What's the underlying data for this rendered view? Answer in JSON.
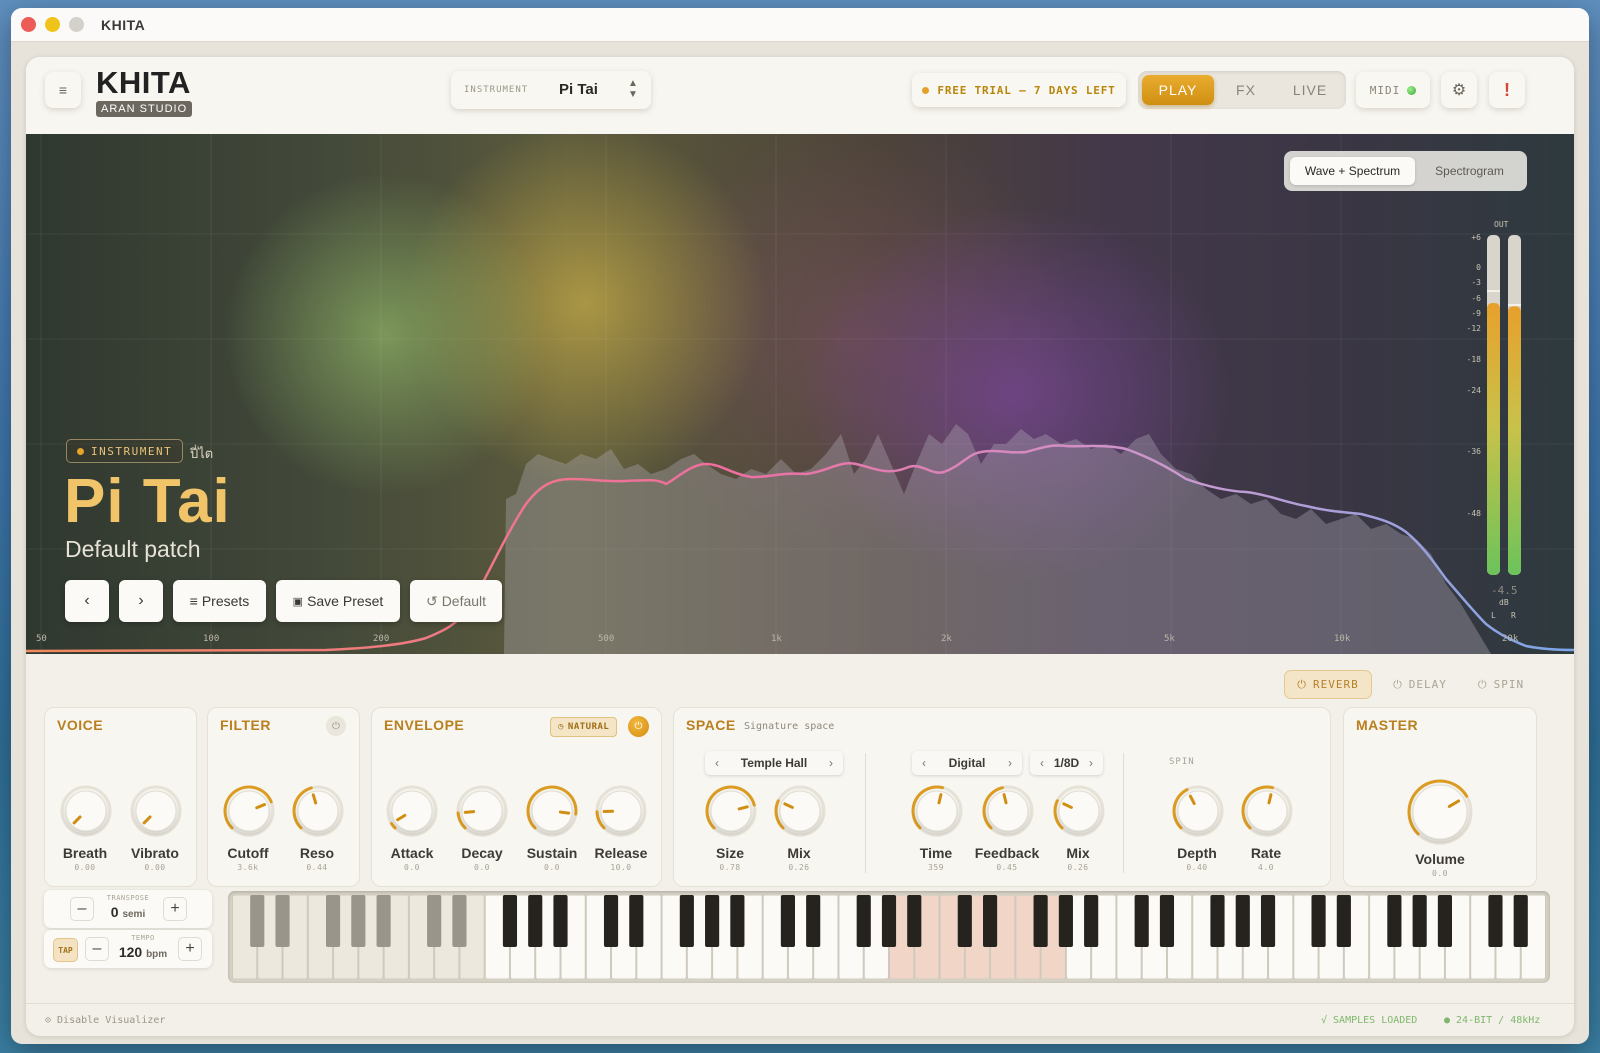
{
  "window": {
    "title": "KHITA"
  },
  "brand": {
    "name": "KHITA",
    "sub": "ARAN STUDIO"
  },
  "instrument_selector": {
    "label": "INSTRUMENT",
    "value": "Pi Tai"
  },
  "trial": {
    "text": "FREE TRIAL — 7 DAYS LEFT"
  },
  "modes": [
    {
      "label": "PLAY",
      "active": true
    },
    {
      "label": "FX",
      "active": false
    },
    {
      "label": "LIVE",
      "active": false
    }
  ],
  "midi": {
    "label": "MIDI"
  },
  "alert": {
    "label": "!"
  },
  "visualizer": {
    "views": [
      {
        "label": "Wave + Spectrum",
        "active": true
      },
      {
        "label": "Spectrogram",
        "active": false
      }
    ],
    "badge": "INSTRUMENT",
    "thai_name": "ปี่ไต",
    "name": "Pi Tai",
    "patch": "Default patch",
    "presets_label": "Presets",
    "save_label": "Save Preset",
    "default_label": "Default",
    "freq_labels": [
      "50",
      "100",
      "200",
      "500",
      "1k",
      "2k",
      "5k",
      "10k",
      "20k"
    ],
    "meter": {
      "title": "OUT",
      "scale": [
        "+6",
        "0",
        "-3",
        "-6",
        "-9",
        "-12",
        "-18",
        "-24",
        "-36",
        "-48"
      ],
      "readout": "-4.5",
      "unit": "dB",
      "left": "L",
      "right": "R",
      "level_l": 0.8,
      "level_r": 0.79
    }
  },
  "fx_tabs": [
    {
      "label": "REVERB",
      "active": true
    },
    {
      "label": "DELAY",
      "active": false
    },
    {
      "label": "SPIN",
      "active": false
    }
  ],
  "voice": {
    "title": "VOICE",
    "knobs": [
      {
        "label": "Breath",
        "value": "0.00"
      },
      {
        "label": "Vibrato",
        "value": "0.00"
      }
    ]
  },
  "filter": {
    "title": "FILTER",
    "knobs": [
      {
        "label": "Cutoff",
        "value": "3.6k"
      },
      {
        "label": "Reso",
        "value": "0.44"
      }
    ]
  },
  "envelope": {
    "title": "ENVELOPE",
    "tag": "NATURAL",
    "knobs": [
      {
        "label": "Attack",
        "value": "0.0"
      },
      {
        "label": "Decay",
        "value": "0.0"
      },
      {
        "label": "Sustain",
        "value": "0.0"
      },
      {
        "label": "Release",
        "value": "10.0"
      }
    ]
  },
  "space": {
    "title": "SPACE",
    "subtitle": "Signature space",
    "reverb_type": "Temple Hall",
    "delay_type": "Digital",
    "delay_division": "1/8D",
    "spin_label": "SPIN",
    "reverb_knobs": [
      {
        "label": "Size",
        "value": "0.78"
      },
      {
        "label": "Mix",
        "value": "0.26"
      }
    ],
    "delay_knobs": [
      {
        "label": "Time",
        "value": "359"
      },
      {
        "label": "Feedback",
        "value": "0.45"
      },
      {
        "label": "Mix",
        "value": "0.26"
      }
    ],
    "spin_knobs": [
      {
        "label": "Depth",
        "value": "0.40"
      },
      {
        "label": "Rate",
        "value": "4.0"
      }
    ]
  },
  "master": {
    "title": "MASTER",
    "knobs": [
      {
        "label": "Volume",
        "value": "0.0"
      }
    ]
  },
  "transpose": {
    "label": "TRANSPOSE",
    "value": "0",
    "unit": "semi"
  },
  "tempo": {
    "label": "TEMPO",
    "tap": "TAP",
    "value": "120",
    "unit": "bpm"
  },
  "status": {
    "visualizer": "⊙ Disable Visualizer",
    "samples": "√ SAMPLES LOADED",
    "format": "● 24-BIT / 48kHz"
  },
  "colors": {
    "accent": "#d99a1e",
    "section_title": "#b8801e",
    "trial_text": "#b8860b"
  }
}
